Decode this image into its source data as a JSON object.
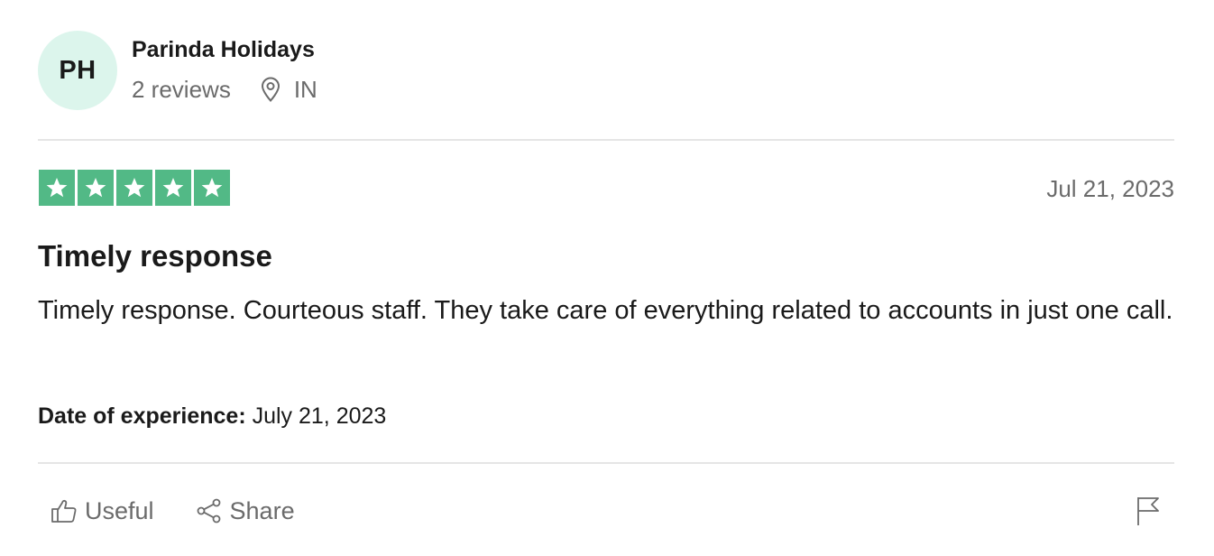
{
  "consumer": {
    "initials": "PH",
    "name": "Parinda Holidays",
    "reviews_count": "2 reviews",
    "country": "IN",
    "avatar_color": "#dcf5ec"
  },
  "review": {
    "rating": 5,
    "rating_max": 5,
    "star_color": "#52b986",
    "date": "Jul 21, 2023",
    "title": "Timely response",
    "text": "Timely response. Courteous staff. They take care of everything related to accounts in just one call.",
    "experience_label": "Date of experience:",
    "experience_date": "July 21, 2023"
  },
  "actions": {
    "useful_label": "Useful",
    "share_label": "Share",
    "useful_icon": "thumbs-up-icon",
    "share_icon": "share-icon",
    "report_icon": "flag-icon",
    "location_icon": "map-pin-icon"
  }
}
